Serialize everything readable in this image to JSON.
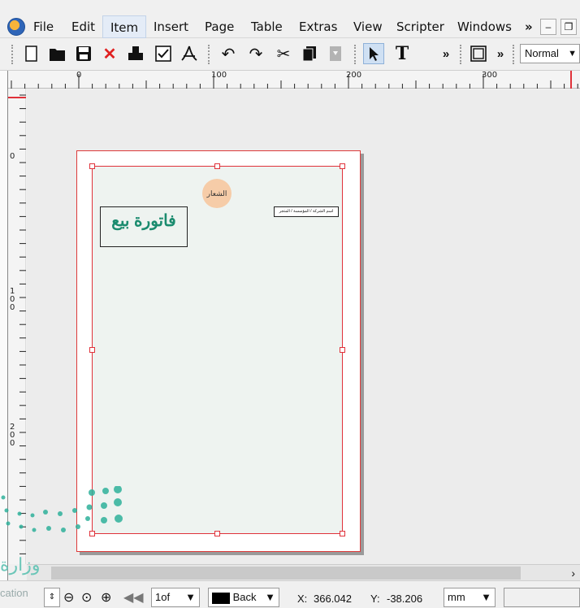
{
  "menu": {
    "items": [
      "File",
      "Edit",
      "Item",
      "Insert",
      "Page",
      "Table",
      "Extras",
      "View",
      "Scripter",
      "Windows"
    ],
    "overflow": "»",
    "active": "Item"
  },
  "toolbar": {
    "icons": [
      "new-document-icon",
      "open-folder-icon",
      "save-icon",
      "close-icon",
      "print-icon",
      "preflight-check-icon",
      "pdf-export-icon",
      "undo-icon",
      "redo-icon",
      "cut-icon",
      "copy-icon",
      "paste-icon",
      "select-arrow-icon",
      "text-frame-icon",
      "frame-icon"
    ],
    "overflow_1": "»",
    "overflow_2": "»",
    "view_mode": "Normal"
  },
  "ruler": {
    "horizontal_labels": [
      "0",
      "100",
      "200",
      "300"
    ],
    "vertical_labels": [
      "0",
      "100",
      "200"
    ]
  },
  "document": {
    "logo_placeholder": "الشعار",
    "title": "فاتورة بيع",
    "company_name": "اسم الشركة / المؤسسة / المتجر"
  },
  "statusbar": {
    "page_number": "1of",
    "layer": "Back",
    "x_label": "X:",
    "x_value": "366.042",
    "y_label": "Y:",
    "y_value": "-38.206",
    "unit": "mm"
  },
  "watermark": {
    "text": "وزارة",
    "sub": "cation"
  },
  "colors": {
    "selection_red": "#e0323a",
    "title_green": "#1a8b6e",
    "logo_peach": "#f6cca8",
    "page_fill": "#eef3f0"
  }
}
